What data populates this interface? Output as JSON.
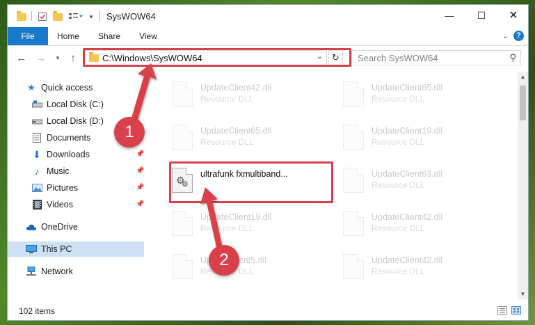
{
  "window": {
    "title": "SysWOW64"
  },
  "ribbon": {
    "tabs": [
      {
        "label": "File"
      },
      {
        "label": "Home"
      },
      {
        "label": "Share"
      },
      {
        "label": "View"
      }
    ]
  },
  "address_bar": {
    "path": "C:\\Windows\\SysWOW64"
  },
  "search": {
    "placeholder": "Search SysWOW64"
  },
  "sidebar": {
    "items": [
      {
        "label": "Quick access",
        "icon": "star-icon"
      },
      {
        "label": "Local Disk (C:)",
        "icon": "drive-icon"
      },
      {
        "label": "Local Disk (D:)",
        "icon": "drive-icon"
      },
      {
        "label": "Documents",
        "icon": "document-icon"
      },
      {
        "label": "Downloads",
        "icon": "download-icon"
      },
      {
        "label": "Music",
        "icon": "music-icon"
      },
      {
        "label": "Pictures",
        "icon": "pictures-icon"
      },
      {
        "label": "Videos",
        "icon": "video-icon"
      },
      {
        "label": "OneDrive",
        "icon": "cloud-icon"
      },
      {
        "label": "This PC",
        "icon": "pc-icon"
      },
      {
        "label": "Network",
        "icon": "network-icon"
      }
    ]
  },
  "files": {
    "items": [
      {
        "name": "UpdateClient42.dll",
        "type": "Resource DLL"
      },
      {
        "name": "UpdateClient65.dll",
        "type": "Resource DLL"
      },
      {
        "name": "UpdateClient65.dll",
        "type": "Resource DLL"
      },
      {
        "name": "UpdateClient19.dll",
        "type": "Resource DLL"
      },
      {
        "name": "ultrafunk fxmultiband...",
        "type": ""
      },
      {
        "name": "UpdateClient63.dll",
        "type": "Resource DLL"
      },
      {
        "name": "UpdateClient19.dll",
        "type": "Resource DLL"
      },
      {
        "name": "UpdateClient42.dll",
        "type": "Resource DLL"
      },
      {
        "name": "UpdateClient5.dll",
        "type": "Resource DLL"
      },
      {
        "name": "UpdateClient42.dll",
        "type": "Resource DLL"
      }
    ]
  },
  "status": {
    "items_count": "102 items"
  },
  "annotations": {
    "step1": "1",
    "step2": "2"
  },
  "colors": {
    "accent": "#1979ca",
    "highlight": "#d9414a",
    "selected": "#cde1f5"
  }
}
